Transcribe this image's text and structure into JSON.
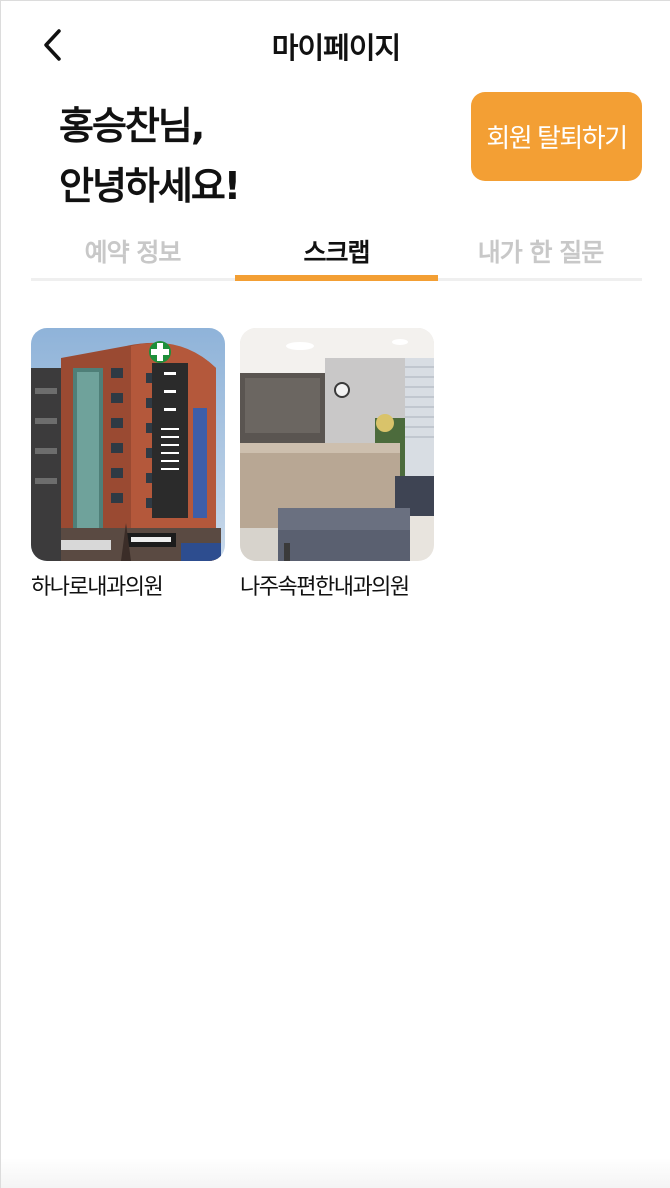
{
  "header": {
    "title": "마이페이지",
    "back_icon": "chevron-left-icon"
  },
  "greeting": {
    "line1": "홍승찬님,",
    "line2": "안녕하세요!"
  },
  "withdraw_button": {
    "label": "회원 탈퇴하기",
    "color": "#f39f34"
  },
  "tabs": [
    {
      "label": "예약 정보",
      "active": false
    },
    {
      "label": "스크랩",
      "active": true
    },
    {
      "label": "내가 한 질문",
      "active": false
    }
  ],
  "accent_color": "#f39f34",
  "scraps": [
    {
      "name": "하나로내과의원",
      "image": "hospital-building-photo"
    },
    {
      "name": "나주속편한내과의원",
      "image": "clinic-lobby-photo"
    }
  ]
}
